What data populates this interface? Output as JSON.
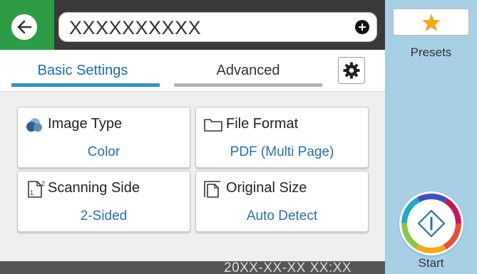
{
  "header": {
    "back_icon": "back-arrow-icon",
    "destination_value": "XXXXXXXXXX",
    "add_icon": "plus-icon"
  },
  "tabs": [
    {
      "label": "Basic Settings",
      "selected": true
    },
    {
      "label": "Advanced",
      "selected": false
    }
  ],
  "settings_icon": "gear-icon",
  "cards": {
    "image_type": {
      "title": "Image Type",
      "value": "Color",
      "icon": "image-type-icon"
    },
    "file_format": {
      "title": "File Format",
      "value": "PDF (Multi Page)",
      "icon": "folder-icon"
    },
    "scanning_side": {
      "title": "Scanning Side",
      "value": "2-Sided",
      "icon": "scanning-side-icon"
    },
    "original_size": {
      "title": "Original Size",
      "value": "Auto Detect",
      "icon": "original-size-icon"
    }
  },
  "status": {
    "datetime": "20XX-XX-XX XX:XX"
  },
  "sidebar": {
    "presets_label": "Presets",
    "presets_icon": "star-icon",
    "start_label": "Start",
    "start_icon": "start-diamond-icon"
  },
  "colors": {
    "accent_blue": "#2a6fa3",
    "back_green": "#2e9c46",
    "sidebar_blue": "#a7cfe6",
    "star_gold": "#f0a81e"
  }
}
